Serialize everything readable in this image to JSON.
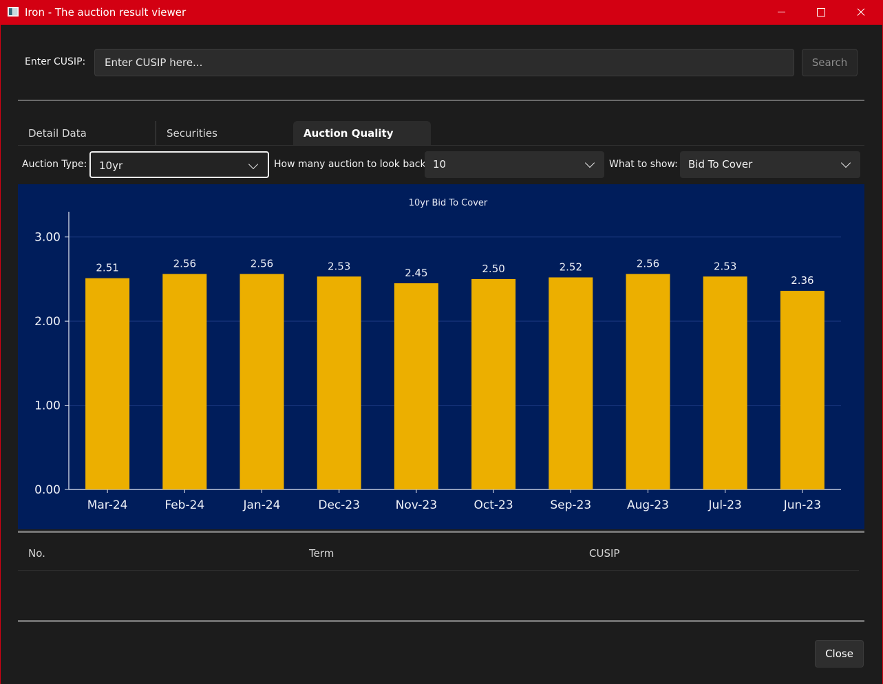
{
  "window": {
    "title": "Iron - The auction result viewer"
  },
  "search": {
    "label": "Enter CUSIP:",
    "placeholder": "Enter CUSIP here...",
    "button_label": "Search"
  },
  "tabs": [
    {
      "label": "Detail Data",
      "active": false
    },
    {
      "label": "Securities",
      "active": false
    },
    {
      "label": "Auction Quality",
      "active": true
    }
  ],
  "controls": {
    "auction_type_label": "Auction Type:",
    "auction_type_value": "10yr",
    "lookback_label": "How many auction to look back:",
    "lookback_value": "10",
    "show_label": "What to show:",
    "show_value": "Bid To Cover"
  },
  "chart_data": {
    "type": "bar",
    "title": "10yr Bid To Cover",
    "xlabel": "",
    "ylabel": "",
    "categories": [
      "Mar-24",
      "Feb-24",
      "Jan-24",
      "Dec-23",
      "Nov-23",
      "Oct-23",
      "Sep-23",
      "Aug-23",
      "Jul-23",
      "Jun-23"
    ],
    "values": [
      2.51,
      2.56,
      2.56,
      2.53,
      2.45,
      2.5,
      2.52,
      2.56,
      2.53,
      2.36
    ],
    "data_labels": [
      "2.51",
      "2.56",
      "2.56",
      "2.53",
      "2.45",
      "2.50",
      "2.52",
      "2.56",
      "2.53",
      "2.36"
    ],
    "ylim": [
      0,
      3.3
    ],
    "yticks": [
      0,
      1,
      2,
      3
    ],
    "ytick_labels": [
      "0.00",
      "1.00",
      "2.00",
      "3.00"
    ],
    "grid": true,
    "bar_color": "#ecaf00",
    "background_color": "#001d5b"
  },
  "table": {
    "columns": [
      "No.",
      "Term",
      "CUSIP"
    ],
    "rows": []
  },
  "footer": {
    "close_label": "Close"
  },
  "colors": {
    "titlebar": "#d30012",
    "window_bg": "#1c1c1c"
  }
}
